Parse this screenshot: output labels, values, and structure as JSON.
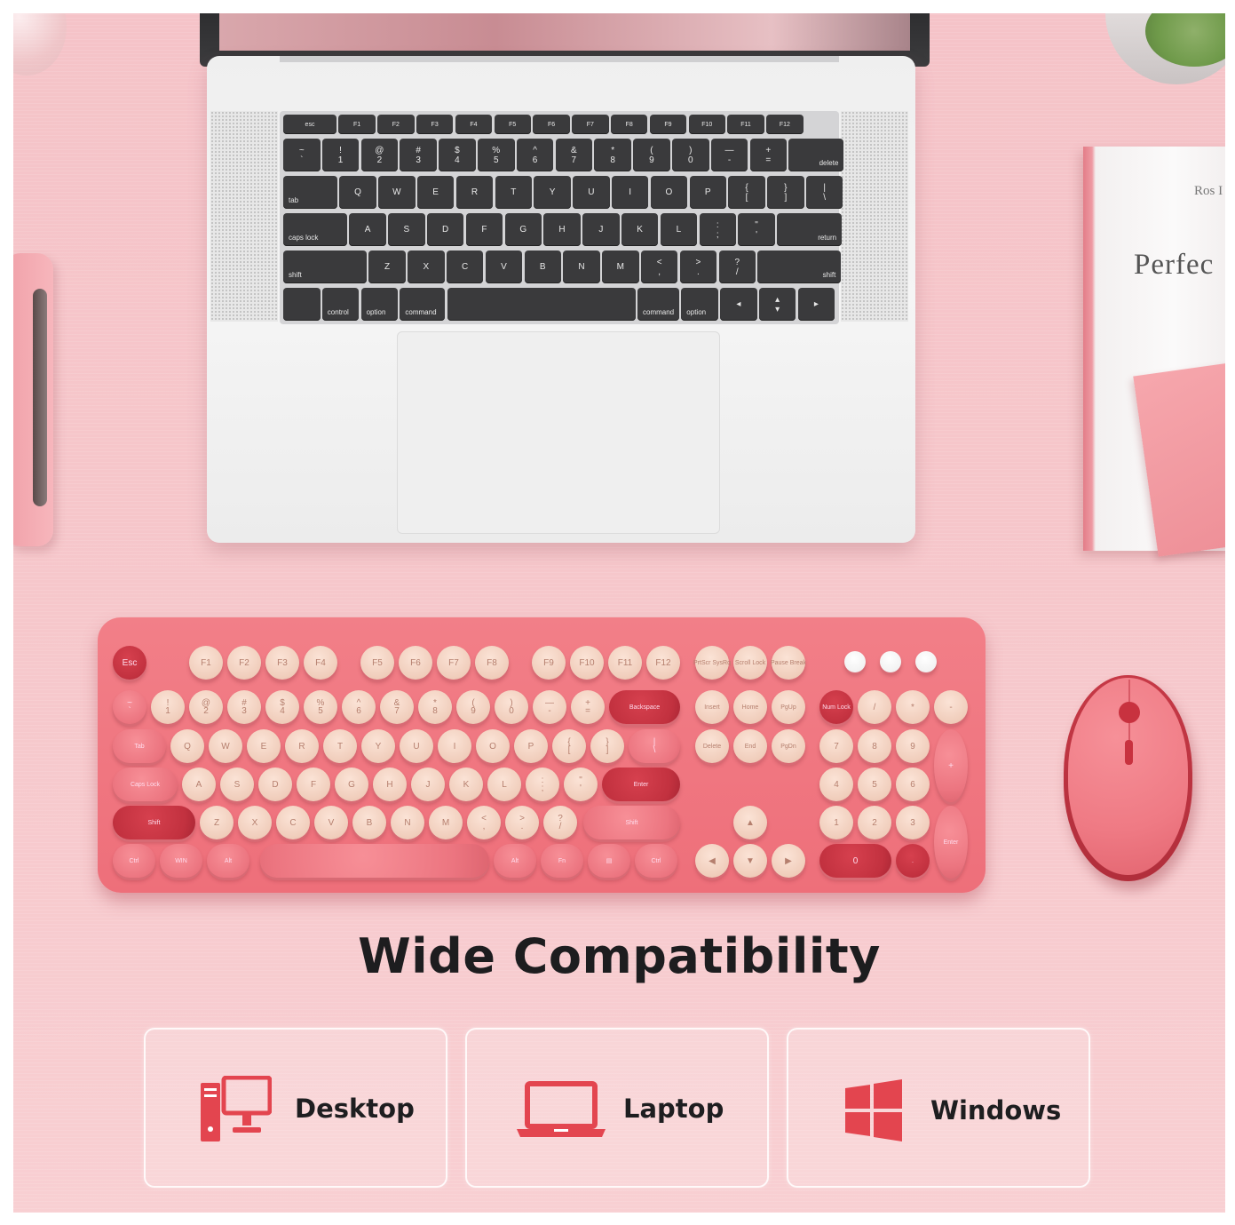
{
  "headline": "Wide Compatibility",
  "book": {
    "author": "Ros I",
    "title": "Perfec"
  },
  "compatibility": [
    {
      "label": "Desktop",
      "icon": "desktop-icon"
    },
    {
      "label": "Laptop",
      "icon": "laptop-icon"
    },
    {
      "label": "Windows",
      "icon": "windows-icon"
    }
  ],
  "colors": {
    "accent": "#e3454f",
    "background": "#f6c7cb",
    "keyboard": "#ef737e",
    "keycap": "#f3d2c1",
    "text": "#1d1d1f"
  },
  "laptop_keys": {
    "fn_row": [
      "esc",
      "F1",
      "F2",
      "F3",
      "F4",
      "F5",
      "F6",
      "F7",
      "F8",
      "F9",
      "F10",
      "F11",
      "F12"
    ],
    "num_row": [
      "~\n`",
      "!\n1",
      "@\n2",
      "#\n3",
      "$\n4",
      "%\n5",
      "^\n6",
      "&\n7",
      "*\n8",
      "(\n9",
      ")\n0",
      "—\n-",
      "+\n=",
      "delete"
    ],
    "top_row": [
      "tab",
      "Q",
      "W",
      "E",
      "R",
      "T",
      "Y",
      "U",
      "I",
      "O",
      "P",
      "{\n[",
      "}\n]",
      "|\n\\"
    ],
    "home_row": [
      "caps lock",
      "A",
      "S",
      "D",
      "F",
      "G",
      "H",
      "J",
      "K",
      "L",
      ":\n;",
      "\"\n'",
      "return"
    ],
    "bottom_row": [
      "shift",
      "Z",
      "X",
      "C",
      "V",
      "B",
      "N",
      "M",
      "<\n,",
      ">\n.",
      "?\n/",
      "shift"
    ],
    "space_row": [
      "",
      "control",
      "option",
      "command",
      "",
      "command",
      "option",
      "◂",
      "▴\n▾",
      "▸"
    ]
  },
  "pink_keys": {
    "fn_row": [
      "Esc",
      "F1",
      "F2",
      "F3",
      "F4",
      "F5",
      "F6",
      "F7",
      "F8",
      "F9",
      "F10",
      "F11",
      "F12",
      "PrtScr SysRq",
      "Scroll Lock",
      "Pause Break"
    ],
    "num_row": [
      "~\n`",
      "!\n1",
      "@\n2",
      "#\n3",
      "$\n4",
      "%\n5",
      "^\n6",
      "&\n7",
      "*\n8",
      "(\n9",
      ")\n0",
      "—\n-",
      "+\n=",
      "Backspace",
      "Insert",
      "Home",
      "PgUp",
      "Num Lock",
      "/",
      "*",
      "-"
    ],
    "top_row": [
      "Tab",
      "Q",
      "W",
      "E",
      "R",
      "T",
      "Y",
      "U",
      "I",
      "O",
      "P",
      "{\n[",
      "}\n]",
      "|\n\\",
      "Delete",
      "End",
      "PgDn",
      "7",
      "8",
      "9",
      "+"
    ],
    "home_row": [
      "Caps Lock",
      "A",
      "S",
      "D",
      "F",
      "G",
      "H",
      "J",
      "K",
      "L",
      ":\n;",
      "\"\n'",
      "Enter",
      "4",
      "5",
      "6"
    ],
    "bottom_row": [
      "Shift",
      "Z",
      "X",
      "C",
      "V",
      "B",
      "N",
      "M",
      "<\n,",
      ">\n.",
      "?\n/",
      "Shift",
      "▲",
      "1",
      "2",
      "3",
      "Enter"
    ],
    "space_row": [
      "Ctrl",
      "WIN",
      "Alt",
      "",
      "Alt",
      "Fn",
      "▤",
      "Ctrl",
      "◀",
      "▼",
      "▶",
      "0",
      "."
    ]
  }
}
